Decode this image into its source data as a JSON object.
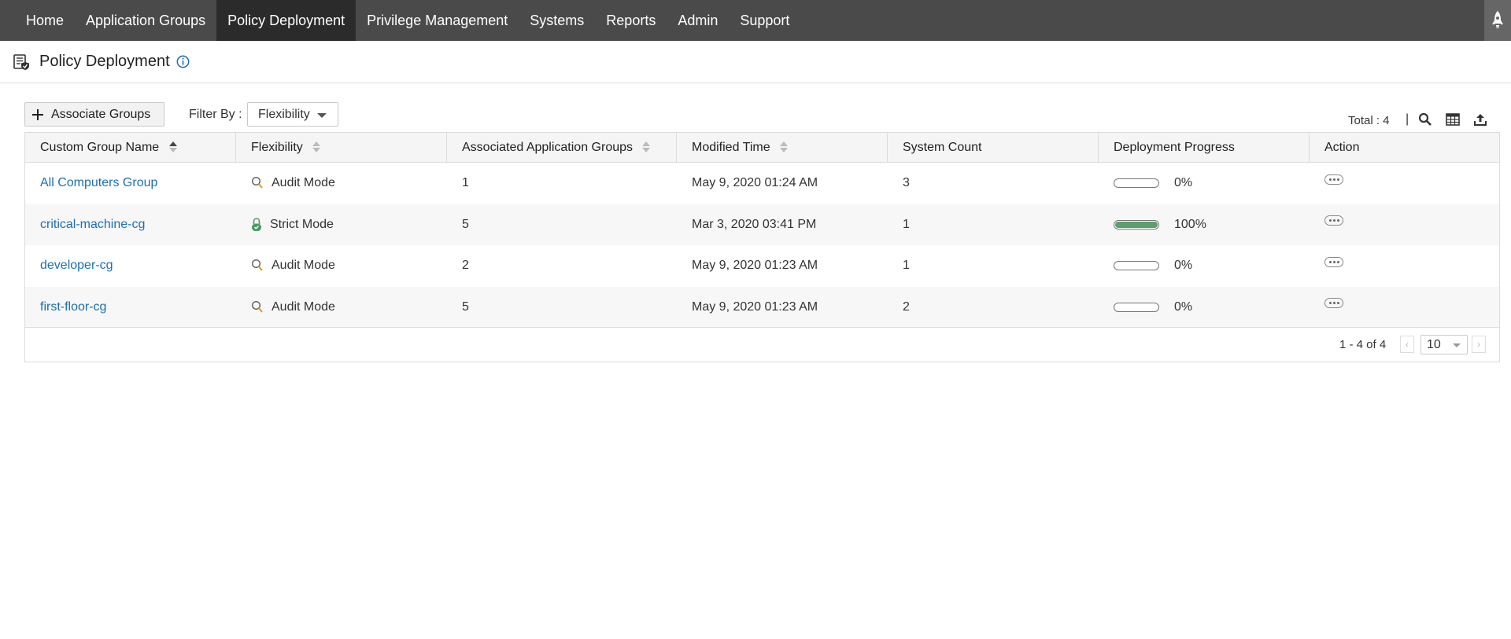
{
  "nav": {
    "items": [
      "Home",
      "Application Groups",
      "Policy Deployment",
      "Privilege Management",
      "Systems",
      "Reports",
      "Admin",
      "Support"
    ],
    "active": "Policy Deployment"
  },
  "page": {
    "title": "Policy Deployment"
  },
  "toolbar": {
    "associate_label": "Associate Groups",
    "filter_label": "Filter By :",
    "filter_value": "Flexibility",
    "total": "Total : 4",
    "separator": "|"
  },
  "table": {
    "columns": [
      "Custom Group Name",
      "Flexibility",
      "Associated Application Groups",
      "Modified Time",
      "System Count",
      "Deployment Progress",
      "Action"
    ],
    "rows": [
      {
        "name": "All Computers Group",
        "flexibility": "Audit Mode",
        "mode_icon": "search-icon",
        "assoc": "1",
        "modified": "May 9, 2020 01:24 AM",
        "systems": "3",
        "progress": 0,
        "progress_label": "0%"
      },
      {
        "name": "critical-machine-cg",
        "flexibility": "Strict Mode",
        "mode_icon": "lock-icon",
        "assoc": "5",
        "modified": "Mar 3, 2020 03:41 PM",
        "systems": "1",
        "progress": 100,
        "progress_label": "100%"
      },
      {
        "name": "developer-cg",
        "flexibility": "Audit Mode",
        "mode_icon": "search-icon",
        "assoc": "2",
        "modified": "May 9, 2020 01:23 AM",
        "systems": "1",
        "progress": 0,
        "progress_label": "0%"
      },
      {
        "name": "first-floor-cg",
        "flexibility": "Audit Mode",
        "mode_icon": "search-icon",
        "assoc": "5",
        "modified": "May 9, 2020 01:23 AM",
        "systems": "2",
        "progress": 0,
        "progress_label": "0%"
      }
    ]
  },
  "pagination": {
    "range": "1 - 4 of 4",
    "page_size": "10",
    "prev": "‹",
    "next": "›"
  },
  "colors": {
    "nav_bg": "#4a4a4a",
    "nav_active": "#2b2b2b",
    "link": "#1a6fb5",
    "progress_fill": "#5c9e6c",
    "strict_green": "#4a9a60"
  }
}
